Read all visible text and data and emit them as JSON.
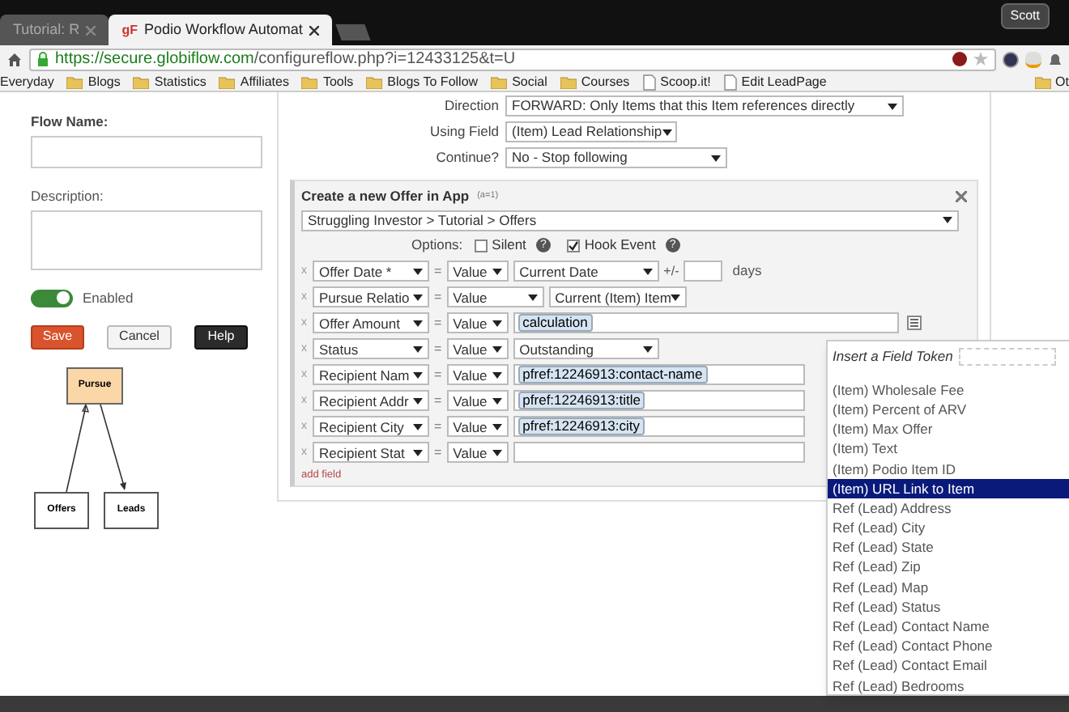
{
  "browser": {
    "tabs": [
      {
        "label": "Tutorial: R",
        "selected": false
      },
      {
        "label": "Podio Workflow Automat",
        "selected": true,
        "favicon": "gF"
      }
    ],
    "profile": "Scott",
    "url_host": "https://secure.globiflow.com",
    "url_path": "/configureflow.php?i=12433125&t=U",
    "bookmarks": [
      {
        "label": "Everyday",
        "kind": "plain"
      },
      {
        "label": "Blogs",
        "kind": "folder"
      },
      {
        "label": "Statistics",
        "kind": "folder"
      },
      {
        "label": "Affiliates",
        "kind": "folder"
      },
      {
        "label": "Tools",
        "kind": "folder"
      },
      {
        "label": "Blogs To Follow",
        "kind": "folder"
      },
      {
        "label": "Social",
        "kind": "folder"
      },
      {
        "label": "Courses",
        "kind": "folder"
      },
      {
        "label": "Scoop.it!",
        "kind": "page"
      },
      {
        "label": "Edit LeadPage",
        "kind": "page"
      },
      {
        "label": "Ot",
        "kind": "folder"
      }
    ]
  },
  "left": {
    "flow_name_label": "Flow Name:",
    "description_label": "Description:",
    "enabled": {
      "label": "Enabled",
      "on": true
    },
    "buttons": [
      {
        "label": "Save",
        "kind": "save"
      },
      {
        "label": "Cancel",
        "kind": "cancel"
      },
      {
        "label": "Help",
        "kind": "help"
      }
    ],
    "diagram": {
      "parent": "Pursue",
      "children": [
        "Offers",
        "Leads"
      ]
    }
  },
  "settings": [
    {
      "label": "Direction",
      "value": "FORWARD: Only Items that this Item references directly"
    },
    {
      "label": "Using Field",
      "value": "(Item) Lead Relationship"
    },
    {
      "label": "Continue?",
      "value": "No - Stop following"
    }
  ],
  "action": {
    "title": "Create a new Offer in App",
    "note": "(a=1)",
    "app": "Struggling Investor > Tutorial > Offers",
    "options_label": "Options:",
    "options": [
      {
        "label": "Silent",
        "checked": false,
        "help": "?"
      },
      {
        "label": "Hook Event",
        "checked": true,
        "help": "?"
      }
    ],
    "fields": [
      {
        "remove": "x",
        "name": "Offer Date *",
        "op": "=",
        "type": "Value",
        "kind": "date",
        "value": "Current Date",
        "plusminus": "+/-",
        "unit": "days"
      },
      {
        "remove": "x",
        "name": "Pursue Relatio",
        "op": "=",
        "type": "Value",
        "kind": "select_wide",
        "value": "Current (Item) Item"
      },
      {
        "remove": "x",
        "name": "Offer Amount",
        "op": "=",
        "type": "Value",
        "kind": "token_list",
        "value": "calculation"
      },
      {
        "remove": "x",
        "name": "Status",
        "op": "=",
        "type": "Value",
        "kind": "select",
        "value": "Outstanding"
      },
      {
        "remove": "x",
        "name": "Recipient Nam",
        "op": "=",
        "type": "Value",
        "kind": "token",
        "value": "pfref:12246913:contact-name"
      },
      {
        "remove": "x",
        "name": "Recipient Addr",
        "op": "=",
        "type": "Value",
        "kind": "token",
        "value": "pfref:12246913:title"
      },
      {
        "remove": "x",
        "name": "Recipient City",
        "op": "=",
        "type": "Value",
        "kind": "token",
        "value": "pfref:12246913:city"
      },
      {
        "remove": "x",
        "name": "Recipient Stat",
        "op": "=",
        "type": "Value",
        "kind": "blank"
      }
    ],
    "add_field": "add field"
  },
  "token_menu": {
    "title": "Insert a Field Token",
    "items": [
      {
        "label": "(Item) Wholesale Fee",
        "selected": false
      },
      {
        "label": "(Item) Percent of ARV",
        "selected": false
      },
      {
        "label": "(Item) Max Offer",
        "selected": false
      },
      {
        "label": "(Item) Text",
        "selected": false
      },
      {
        "label": "(Item) Podio Item ID",
        "selected": false
      },
      {
        "label": "(Item) URL Link to Item",
        "selected": true
      },
      {
        "label": "Ref (Lead) Address",
        "selected": false
      },
      {
        "label": "Ref (Lead) City",
        "selected": false
      },
      {
        "label": "Ref (Lead) State",
        "selected": false
      },
      {
        "label": "Ref (Lead) Zip",
        "selected": false
      },
      {
        "label": "Ref (Lead) Map",
        "selected": false
      },
      {
        "label": "Ref (Lead) Status",
        "selected": false
      },
      {
        "label": "Ref (Lead) Contact Name",
        "selected": false
      },
      {
        "label": "Ref (Lead) Contact Phone",
        "selected": false
      },
      {
        "label": "Ref (Lead) Contact Email",
        "selected": false
      },
      {
        "label": "Ref (Lead) Bedrooms",
        "selected": false
      }
    ]
  }
}
